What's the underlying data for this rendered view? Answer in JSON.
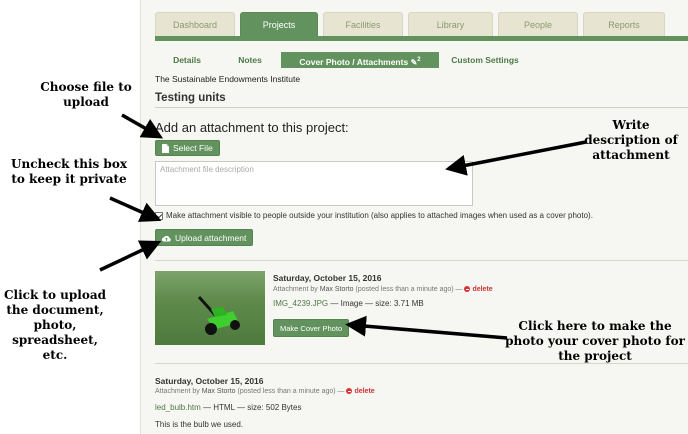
{
  "tabs": [
    "Dashboard",
    "Projects",
    "Facilities",
    "Library",
    "People",
    "Reports"
  ],
  "active_tab": "Projects",
  "subtabs": [
    "Details",
    "Notes",
    "Cover Photo / Attachments",
    "Custom Settings"
  ],
  "attachments_count": "2",
  "institution": "The Sustainable Endowments Institute",
  "project_title": "Testing units",
  "add_heading": "Add an attachment to this project:",
  "select_file_label": "Select File",
  "description_placeholder": "Attachment file description",
  "visibility_label": "Make attachment visible to people outside your institution (also applies to attached images when used as a cover photo).",
  "upload_label": "Upload attachment",
  "entries": [
    {
      "date": "Saturday, October 15, 2016",
      "attached_by": "Attachment by",
      "user": "Max Storto",
      "posted": "(posted less than a minute ago) —",
      "delete_label": "delete",
      "filename": "IMG_4239.JPG",
      "filetype": "— Image — size: 3.71 MB",
      "cover_button": "Make Cover Photo"
    },
    {
      "date": "Saturday, October 15, 2016",
      "attached_by": "Attachment by",
      "user": "Max Storto",
      "posted": "(posted less than a minute ago) —",
      "delete_label": "delete",
      "filename": "led_bulb.htm",
      "filetype": "— HTML — size: 502 Bytes",
      "description": "This is the bulb we used."
    }
  ],
  "annotations": {
    "choose_file": "Choose file to upload",
    "write_desc": "Write description of attachment",
    "uncheck": "Uncheck this box to keep it private",
    "click_upload": "Click to upload the document, photo, spreadsheet, etc.",
    "click_cover": "Click here to make the photo your cover photo for the project"
  },
  "colors": {
    "accent": "#62935e",
    "tab_inactive": "#e7e4d2",
    "delete": "#cc3333"
  },
  "icons": [
    "file-icon",
    "upload-icon",
    "paperclip-icon",
    "delete-icon"
  ]
}
